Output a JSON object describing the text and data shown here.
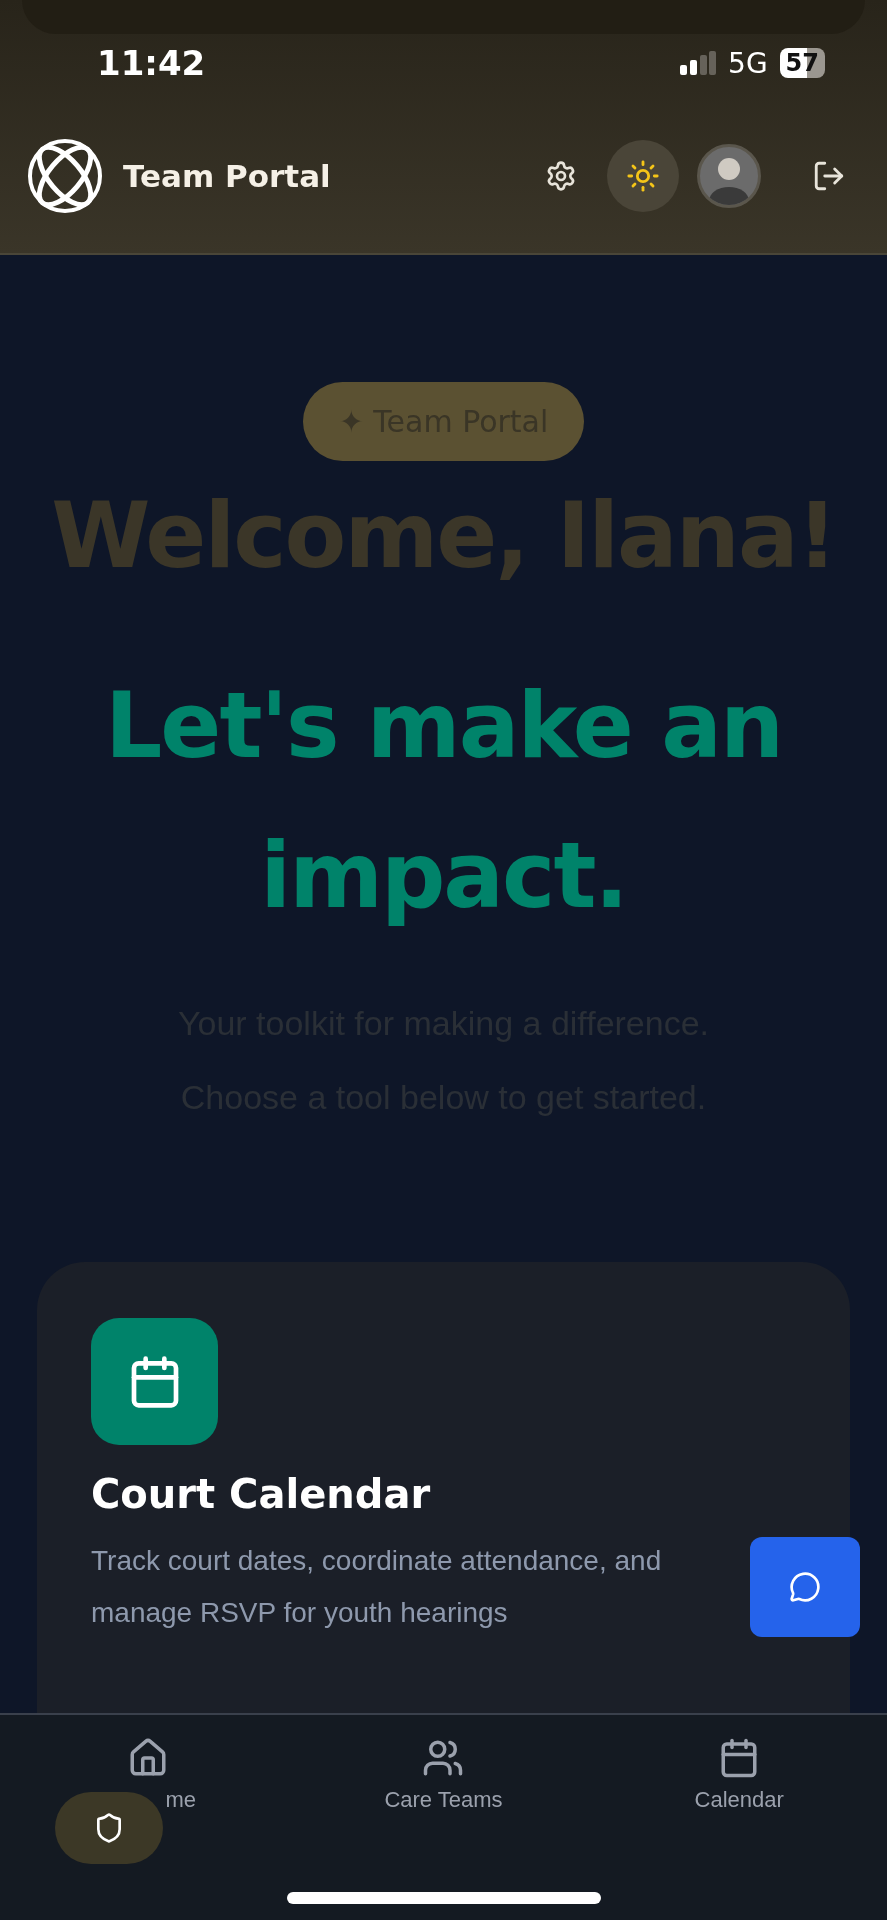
{
  "status_bar": {
    "time": "11:42",
    "network": "5G",
    "battery": "57"
  },
  "header": {
    "title": "Team Portal"
  },
  "hero": {
    "badge": "✦ Team Portal",
    "greeting": "Welcome, Ilana!",
    "headline": "Let's make an impact.",
    "subtitle": [
      "Your toolkit for making a difference.",
      "Choose a tool below to get started."
    ]
  },
  "tools": [
    {
      "title": "Court Calendar",
      "description": "Track court dates, coordinate attendance, and manage RSVP for youth hearings"
    }
  ],
  "bottom_nav": [
    {
      "label": "me"
    },
    {
      "label": "Care Teams"
    },
    {
      "label": "Calendar"
    }
  ]
}
